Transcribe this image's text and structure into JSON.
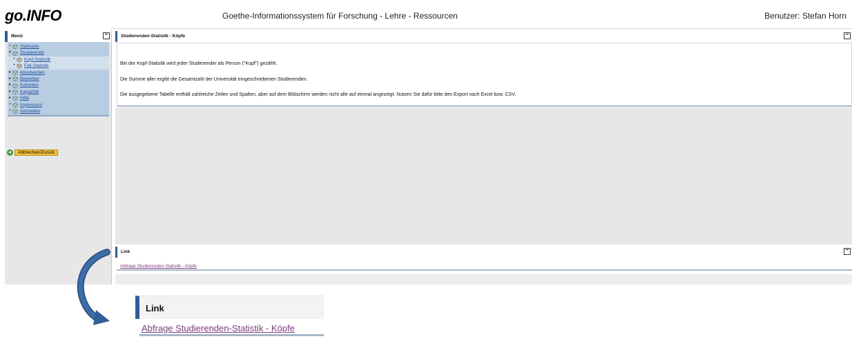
{
  "header": {
    "logo": "go.INFO",
    "subtitle": "Goethe-Informationssystem für Forschung - Lehre - Ressourcen",
    "user": "Benutzer: Stefan Horn"
  },
  "sidebar": {
    "title": "Menü",
    "items": [
      {
        "label": "Startseite",
        "marker": "•",
        "sub": false
      },
      {
        "label": "Studierende",
        "marker": "▾",
        "sub": false
      },
      {
        "label": "Kopf-Statistik",
        "marker": "•",
        "sub": true
      },
      {
        "label": "Fall-Statistik",
        "marker": "•",
        "sub": true
      },
      {
        "label": "Absolventen",
        "marker": "▸",
        "sub": false
      },
      {
        "label": "Bewerber",
        "marker": "▸",
        "sub": false
      },
      {
        "label": "Kohorten",
        "marker": "▸",
        "sub": false
      },
      {
        "label": "Kapazität",
        "marker": "▸",
        "sub": false
      },
      {
        "label": "Hilfe",
        "marker": "▸",
        "sub": false
      },
      {
        "label": "Impressum",
        "marker": "•",
        "sub": false
      },
      {
        "label": "Abmelden",
        "marker": "•",
        "sub": false
      }
    ],
    "back_label": "Abbrechen/Zurück"
  },
  "content": {
    "title": "Studierenden-Statistik - Köpfe",
    "lines": [
      "Bei der Kopf-Statistik wird jeder Studierender als Person (\"Kopf\") gezählt.",
      "Die Summe aller ergibt die Gesamtzahl der Universität eingeschriebenen Studierenden.",
      "Die ausgegebene Tabelle enthält zahlreiche Zeilen und Spalten, aber auf dem Bildschirm werden nicht alle auf einmal angezeigt. Nutzen Sie dafür bitte den Export nach Excel bzw. CSV."
    ]
  },
  "link_panel": {
    "title": "Link",
    "link_text": "Abfrage Studierenden-Statistik - Köpfe"
  },
  "zoom": {
    "title": "Link",
    "link_text": "Abfrage Studierenden-Statistik - Köpfe"
  },
  "colors": {
    "accent": "#2f5d99",
    "menu_bg": "#b9cde2",
    "link_visited": "#7a3c7a",
    "back_button": "#f5c33b"
  },
  "icons": {
    "menu_item": "box-icon",
    "back": "back-arrow-icon",
    "collapse": "minimize-icon",
    "callout": "curved-arrow-icon"
  }
}
